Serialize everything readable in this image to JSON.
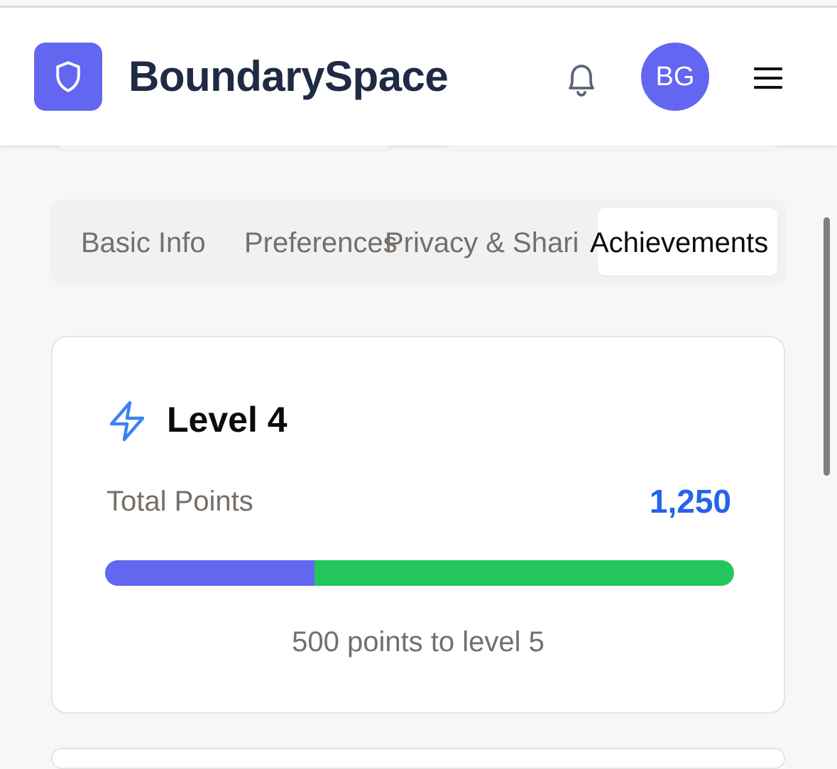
{
  "app": {
    "title": "BoundarySpace",
    "avatar_initials": "BG"
  },
  "header": {
    "logo_icon": "shield-icon",
    "notification_icon": "bell-icon",
    "menu_icon": "hamburger-menu-icon"
  },
  "tabs": [
    {
      "label": "Basic Info",
      "active": false
    },
    {
      "label": "Preferences",
      "active": false
    },
    {
      "label": "Privacy & Shari",
      "active": false
    },
    {
      "label": "Achievements",
      "active": true
    }
  ],
  "level_card": {
    "icon": "lightning-bolt-icon",
    "title": "Level 4",
    "points_label": "Total Points",
    "points_value": "1,250",
    "progress_fraction": 0.333,
    "progress_caption": "500 points to level 5"
  },
  "colors": {
    "accent": "#6366f1",
    "points_blue": "#2563eb",
    "progress_remaining": "#22c55e",
    "title_text": "#1f2a44"
  }
}
